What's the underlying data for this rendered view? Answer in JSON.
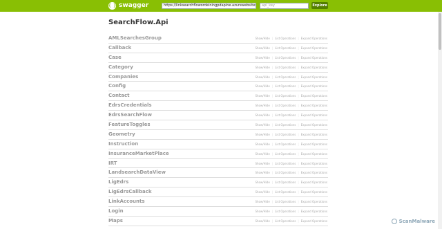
{
  "header": {
    "logo_text": "swagger",
    "logo_icon": "{ }",
    "url_value": "https://linksearchflowordeiningpdapine.azurewebsites.net:443/",
    "api_key_placeholder": "api_key",
    "explore_label": "Explore",
    "bar_color": "#89bf04"
  },
  "api_title": "SearchFlow.Api",
  "operations_labels": {
    "show_hide": "Show/Hide",
    "list_operations": "List Operations",
    "expand_operations": "Expand Operations"
  },
  "resources": [
    "AMLSearchesGroup",
    "Callback",
    "Case",
    "Category",
    "Companies",
    "Config",
    "Contact",
    "EdrsCredentials",
    "EdrsSearchFlow",
    "FeatureToggles",
    "Geometry",
    "Instruction",
    "InsuranceMarketPlace",
    "IRT",
    "LandsearchDataView",
    "LigEdrs",
    "LigEdrsCallback",
    "LinkAccounts",
    "Login",
    "Maps"
  ],
  "watermark": {
    "text": "ScanMalware",
    "icon": "globe-icon"
  }
}
